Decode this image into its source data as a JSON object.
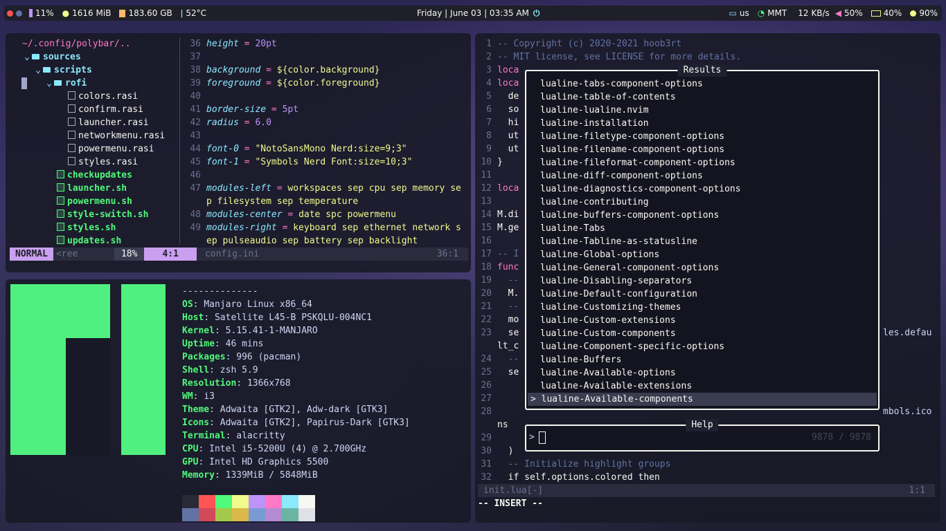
{
  "topbar": {
    "cpu": "11%",
    "memory": "1616 MiB",
    "disk": "183.60 GB",
    "temp": "52°C",
    "datetime": "Friday | June 03 | 03:35 AM",
    "keyboard": "us",
    "network": "MMT",
    "speed": "12 KB/s",
    "volume": "50%",
    "battery": "40%",
    "brightness": "90%",
    "colors": {
      "red": "#ff5555",
      "accent": "#bd93f9",
      "green": "#50fa7b",
      "yellow": "#f1fa8c"
    }
  },
  "tree": {
    "root": "~/.config/polybar/..",
    "sources": "sources",
    "scripts": "scripts",
    "rofi": "rofi",
    "rofi_files": [
      "colors.rasi",
      "confirm.rasi",
      "launcher.rasi",
      "networkmenu.rasi",
      "powermenu.rasi",
      "styles.rasi"
    ],
    "scripts_files": [
      "checkupdates",
      "launcher.sh",
      "powermenu.sh",
      "style-switch.sh",
      "styles.sh",
      "updates.sh"
    ]
  },
  "editor1": {
    "lines": [
      {
        "n": "36",
        "k": "height",
        "v": "20pt",
        "t": "num"
      },
      {
        "n": "37",
        "k": "",
        "v": "",
        "t": ""
      },
      {
        "n": "38",
        "k": "background",
        "v": "${color.background}",
        "t": "str"
      },
      {
        "n": "39",
        "k": "foreground",
        "v": "${color.foreground}",
        "t": "str"
      },
      {
        "n": "40",
        "k": "",
        "v": "",
        "t": ""
      },
      {
        "n": "41",
        "k": "border-size",
        "v": "5pt",
        "t": "num"
      },
      {
        "n": "42",
        "k": "radius",
        "v": "6.0",
        "t": "num"
      },
      {
        "n": "43",
        "k": "",
        "v": "",
        "t": ""
      },
      {
        "n": "44",
        "k": "font-0",
        "v": "\"NotoSansMono Nerd:size=9;3\"",
        "t": "str"
      },
      {
        "n": "45",
        "k": "font-1",
        "v": "\"Symbols Nerd Font:size=10;3\"",
        "t": "str"
      },
      {
        "n": "46",
        "k": "",
        "v": "",
        "t": ""
      },
      {
        "n": "47",
        "k": "modules-left",
        "v": "workspaces sep cpu sep memory se",
        "t": "str"
      },
      {
        "n": "",
        "k": "",
        "v": "p filesystem sep temperature",
        "t": "str"
      },
      {
        "n": "48",
        "k": "modules-center",
        "v": "date spc powermenu",
        "t": "str"
      },
      {
        "n": "49",
        "k": "modules-right",
        "v": "keyboard sep ethernet network s",
        "t": "str"
      },
      {
        "n": "",
        "k": "",
        "v": "ep pulseaudio sep battery sep backlight",
        "t": "str"
      }
    ],
    "status": {
      "mode": "NORMAL",
      "tree": "<ree",
      "percent": "18%",
      "pos": "4:1",
      "file": "config.ini",
      "filepos": "36:1"
    }
  },
  "fetch": {
    "sep": "--------------",
    "rows": [
      {
        "k": "OS",
        "v": "Manjaro Linux x86_64"
      },
      {
        "k": "Host",
        "v": "Satellite L45-B PSKQLU-004NC1"
      },
      {
        "k": "Kernel",
        "v": "5.15.41-1-MANJARO"
      },
      {
        "k": "Uptime",
        "v": "46 mins"
      },
      {
        "k": "Packages",
        "v": "996 (pacman)"
      },
      {
        "k": "Shell",
        "v": "zsh 5.9"
      },
      {
        "k": "Resolution",
        "v": "1366x768"
      },
      {
        "k": "WM",
        "v": "i3"
      },
      {
        "k": "Theme",
        "v": "Adwaita [GTK2], Adw-dark [GTK3]"
      },
      {
        "k": "Icons",
        "v": "Adwaita [GTK2], Papirus-Dark [GTK3]"
      },
      {
        "k": "Terminal",
        "v": "alacritty"
      },
      {
        "k": "CPU",
        "v": "Intel i5-5200U (4) @ 2.700GHz"
      },
      {
        "k": "GPU",
        "v": "Intel HD Graphics 5500"
      },
      {
        "k": "Memory",
        "v": "1339MiB / 5848MiB"
      }
    ],
    "palette_top": [
      "#282a36",
      "#ff5555",
      "#50fa7b",
      "#f1fa8c",
      "#bd93f9",
      "#ff79c6",
      "#8be9fd",
      "#f8f8f2"
    ],
    "palette_bottom": [
      "#6272a4",
      "#d14a5a",
      "#a3c94a",
      "#dab94a",
      "#7a9ad4",
      "#b48ad4",
      "#6ab4a4",
      "#e0e0e8"
    ],
    "logo_color": "#50f080"
  },
  "editor2": {
    "lines": [
      {
        "n": "1",
        "t": "-- Copyright (c) 2020-2021 hoob3rt",
        "c": "cm"
      },
      {
        "n": "2",
        "t": "-- MIT license, see LICENSE for more details.",
        "c": "cm"
      },
      {
        "n": "3",
        "t": "loca",
        "c": "op"
      },
      {
        "n": "4",
        "t": "loca",
        "c": "op"
      },
      {
        "n": "5",
        "t": "  de",
        "c": "file"
      },
      {
        "n": "6",
        "t": "  so",
        "c": "file"
      },
      {
        "n": "7",
        "t": "  hi",
        "c": "file"
      },
      {
        "n": "8",
        "t": "  ut",
        "c": "file"
      },
      {
        "n": "9",
        "t": "  ut",
        "c": "file"
      },
      {
        "n": "10",
        "t": "}",
        "c": "file"
      },
      {
        "n": "11",
        "t": "",
        "c": "file"
      },
      {
        "n": "12",
        "t": "loca",
        "c": "op"
      },
      {
        "n": "13",
        "t": "",
        "c": "file"
      },
      {
        "n": "14",
        "t": "M.di",
        "c": "file"
      },
      {
        "n": "15",
        "t": "M.ge",
        "c": "file"
      },
      {
        "n": "16",
        "t": "",
        "c": "file"
      },
      {
        "n": "17",
        "t": "-- I",
        "c": "cm"
      },
      {
        "n": "18",
        "t": "func",
        "c": "op"
      },
      {
        "n": "19",
        "t": "  --",
        "c": "cm"
      },
      {
        "n": "20",
        "t": "  M.",
        "c": "file"
      },
      {
        "n": "21",
        "t": "  --",
        "c": "cm"
      },
      {
        "n": "22",
        "t": "  mo",
        "c": "file"
      },
      {
        "n": "23",
        "t": "  se",
        "c": "file"
      },
      {
        "n": "",
        "t": "lt_c",
        "c": "file"
      },
      {
        "n": "24",
        "t": "  --",
        "c": "cm"
      },
      {
        "n": "25",
        "t": "  se",
        "c": "file"
      },
      {
        "n": "26",
        "t": "",
        "c": "file"
      },
      {
        "n": "27",
        "t": "",
        "c": "file"
      },
      {
        "n": "28",
        "t": "",
        "c": "file"
      },
      {
        "n": "",
        "t": "ns",
        "c": "file"
      },
      {
        "n": "29",
        "t": "",
        "c": "file"
      },
      {
        "n": "30",
        "t": "  )",
        "c": "file"
      },
      {
        "n": "31",
        "t": "  -- Initialize highlight groups",
        "c": "cm"
      },
      {
        "n": "32",
        "t": "  if self.options.colored then",
        "c": "file"
      }
    ],
    "right_tail1": "les.defau",
    "right_tail2": "mbols.ico",
    "status_file": "init.lua[-]",
    "status_pos": "1:1",
    "mode": "-- INSERT --"
  },
  "results": {
    "title": "Results",
    "items": [
      "lualine-tabs-component-options",
      "lualine-table-of-contents",
      "lualine-lualine.nvim",
      "lualine-installation",
      "lualine-filetype-component-options",
      "lualine-filename-component-options",
      "lualine-fileformat-component-options",
      "lualine-diff-component-options",
      "lualine-diagnostics-component-options",
      "lualine-contributing",
      "lualine-buffers-component-options",
      "lualine-Tabs",
      "lualine-Tabline-as-statusline",
      "lualine-Global-options",
      "lualine-General-component-options",
      "lualine-Disabling-separators",
      "lualine-Default-configuration",
      "lualine-Customizing-themes",
      "lualine-Custom-extensions",
      "lualine-Custom-components",
      "lualine-Component-specific-options",
      "lualine-Buffers",
      "lualine-Available-options",
      "lualine-Available-extensions",
      "lualine-Available-components"
    ],
    "selected_prefix": ">"
  },
  "help": {
    "title": "Help",
    "prompt": ">",
    "count": "9878 / 9878"
  }
}
